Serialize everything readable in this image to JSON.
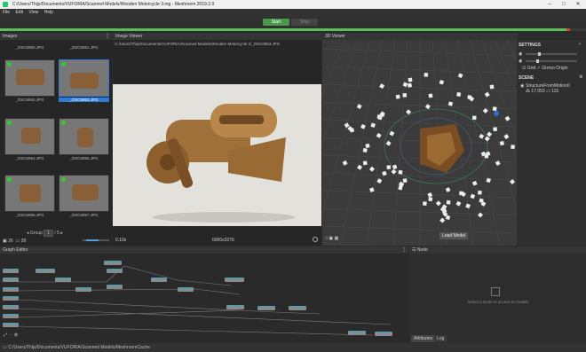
{
  "window": {
    "title": "C:/Users/Thijs/Documents/VUFORIA/Scanned Models/Wooden Motorcycle 3.mg - Meshroom 2019.2.0"
  },
  "menu": [
    "File",
    "Edit",
    "View",
    "Help"
  ],
  "toolbar": {
    "start_label": "Start",
    "stop_label": "Stop",
    "progress": 0.97
  },
  "images": {
    "header": "Images",
    "top_labels": [
      "_DSC6950.JPG",
      "_DSC6951.JPG"
    ],
    "thumbs": [
      "_DSC6952.JPG",
      "_DSC6953.JPG",
      "_DSC6954.JPG",
      "_DSC6955.JPG",
      "_DSC6956.JPG",
      "_DSC6957.JPG"
    ],
    "selected_index": 1,
    "count_images": "26",
    "count_cameras": "28",
    "group_label": "Group",
    "group_value": "1",
    "group_total": "/ 5"
  },
  "image_viewer": {
    "header": "Image Viewer",
    "path": "C:/Users/Thijs/Documents/VUFORIA/Scanned Models/Wooden Motorcycle 2/_DSC6953.JPG",
    "zoom": "0.10x",
    "resolution": "6000x3376"
  },
  "viewer3d": {
    "header": "3D Viewer",
    "tooltip": "Load Model"
  },
  "settings": {
    "header": "SETTINGS",
    "grid_label": "Grid",
    "gizmo_label": "Gizmo",
    "origin_label": "Origin",
    "scene_header": "SCENE",
    "scene_item": "StructureFromMotion0",
    "points": "17,053",
    "cams": "115"
  },
  "graph_editor": {
    "header": "Graph Editor"
  },
  "node_panel": {
    "header": "Node",
    "placeholder": "Select a Node to access its Details",
    "tab_attributes": "Attributes",
    "tab_log": "Log"
  },
  "status": {
    "path": "C:/Users/Thijs/Documents/VUFORIA/Scanned Models/MeshroomCache"
  },
  "colors": {
    "accent_green": "#5bbf5b",
    "selection_blue": "#2f7bd6",
    "error_red": "#d9443a"
  }
}
